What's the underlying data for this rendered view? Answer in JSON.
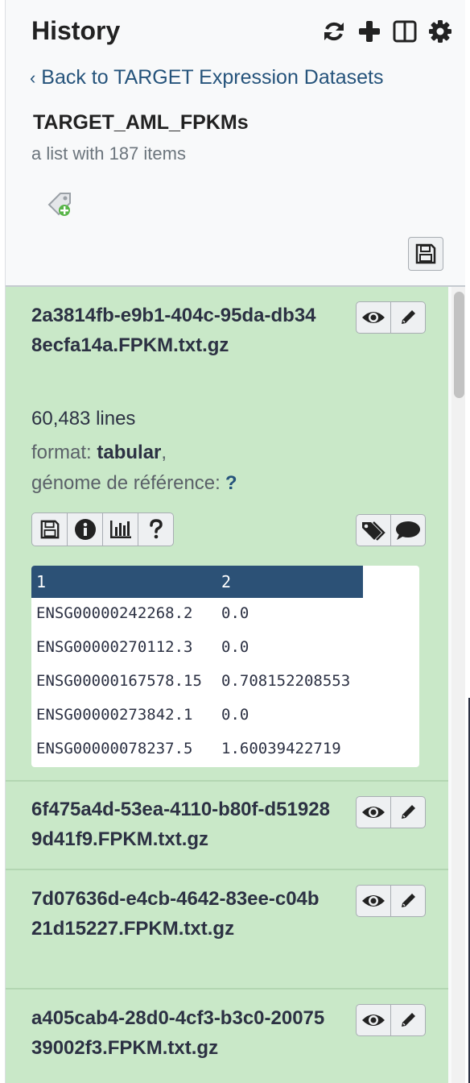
{
  "header": {
    "title": "History",
    "icons": [
      "sync-icon",
      "plus-icon",
      "columns-icon",
      "gear-icon"
    ]
  },
  "back_link": "Back to TARGET Expression Datasets",
  "collection": {
    "name": "TARGET_AML_FPKMs",
    "subtitle": "a list with 187 items"
  },
  "items": [
    {
      "name": "2a3814fb-e9b1-404c-95da-db348ecfa14a.FPKM.txt.gz",
      "lines": "60,483 lines",
      "format_label": "format: ",
      "format_value": "tabular",
      "format_sep": ",",
      "genome_label": "génome de référence:",
      "genome_value": "?",
      "peek": {
        "headers": [
          "1",
          "2"
        ],
        "rows": [
          [
            "ENSG00000242268.2",
            "0.0"
          ],
          [
            "ENSG00000270112.3",
            "0.0"
          ],
          [
            "ENSG00000167578.15",
            "0.708152208553"
          ],
          [
            "ENSG00000273842.1",
            "0.0"
          ],
          [
            "ENSG00000078237.5",
            "1.60039422719"
          ]
        ]
      }
    },
    {
      "name": "6f475a4d-53ea-4110-b80f-d519289d41f9.FPKM.txt.gz"
    },
    {
      "name": "7d07636d-e4cb-4642-83ee-c04b21d15227.FPKM.txt.gz"
    },
    {
      "name": "a405cab4-28d0-4cf3-b3c0-2007539002f3.FPKM.txt.gz"
    }
  ],
  "colors": {
    "item_ok_bg": "#c9e8c8",
    "link": "#25537b",
    "peek_header": "#2c5176"
  }
}
